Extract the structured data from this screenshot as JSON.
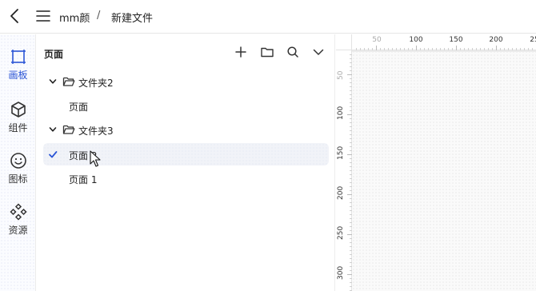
{
  "header": {
    "user": "mm颜",
    "separator": "/",
    "file_name": "新建文件"
  },
  "rail": {
    "items": [
      {
        "label": "画板",
        "icon": "artboard-icon",
        "active": true
      },
      {
        "label": "组件",
        "icon": "cube-icon",
        "active": false
      },
      {
        "label": "图标",
        "icon": "smiley-icon",
        "active": false
      },
      {
        "label": "资源",
        "icon": "diamonds-icon",
        "active": false
      }
    ]
  },
  "panel": {
    "title": "页面",
    "tools": [
      "plus-icon",
      "folder-icon",
      "search-icon",
      "chevron-down-icon"
    ],
    "tree": [
      {
        "type": "folder",
        "label": "文件夹2",
        "expanded": true
      },
      {
        "type": "page",
        "label": "页面"
      },
      {
        "type": "folder",
        "label": "文件夹3",
        "expanded": true
      },
      {
        "type": "page",
        "label": "页面 2",
        "selected": true
      },
      {
        "type": "page",
        "label": "页面 1"
      }
    ]
  },
  "ruler": {
    "horizontal_labels": [
      "50",
      "100",
      "150",
      "200",
      "25"
    ],
    "vertical_labels": [
      "50",
      "100",
      "150",
      "200",
      "250",
      "300"
    ]
  },
  "colors": {
    "accent": "#2b55d6",
    "selected_row": "#f1f3f8"
  }
}
